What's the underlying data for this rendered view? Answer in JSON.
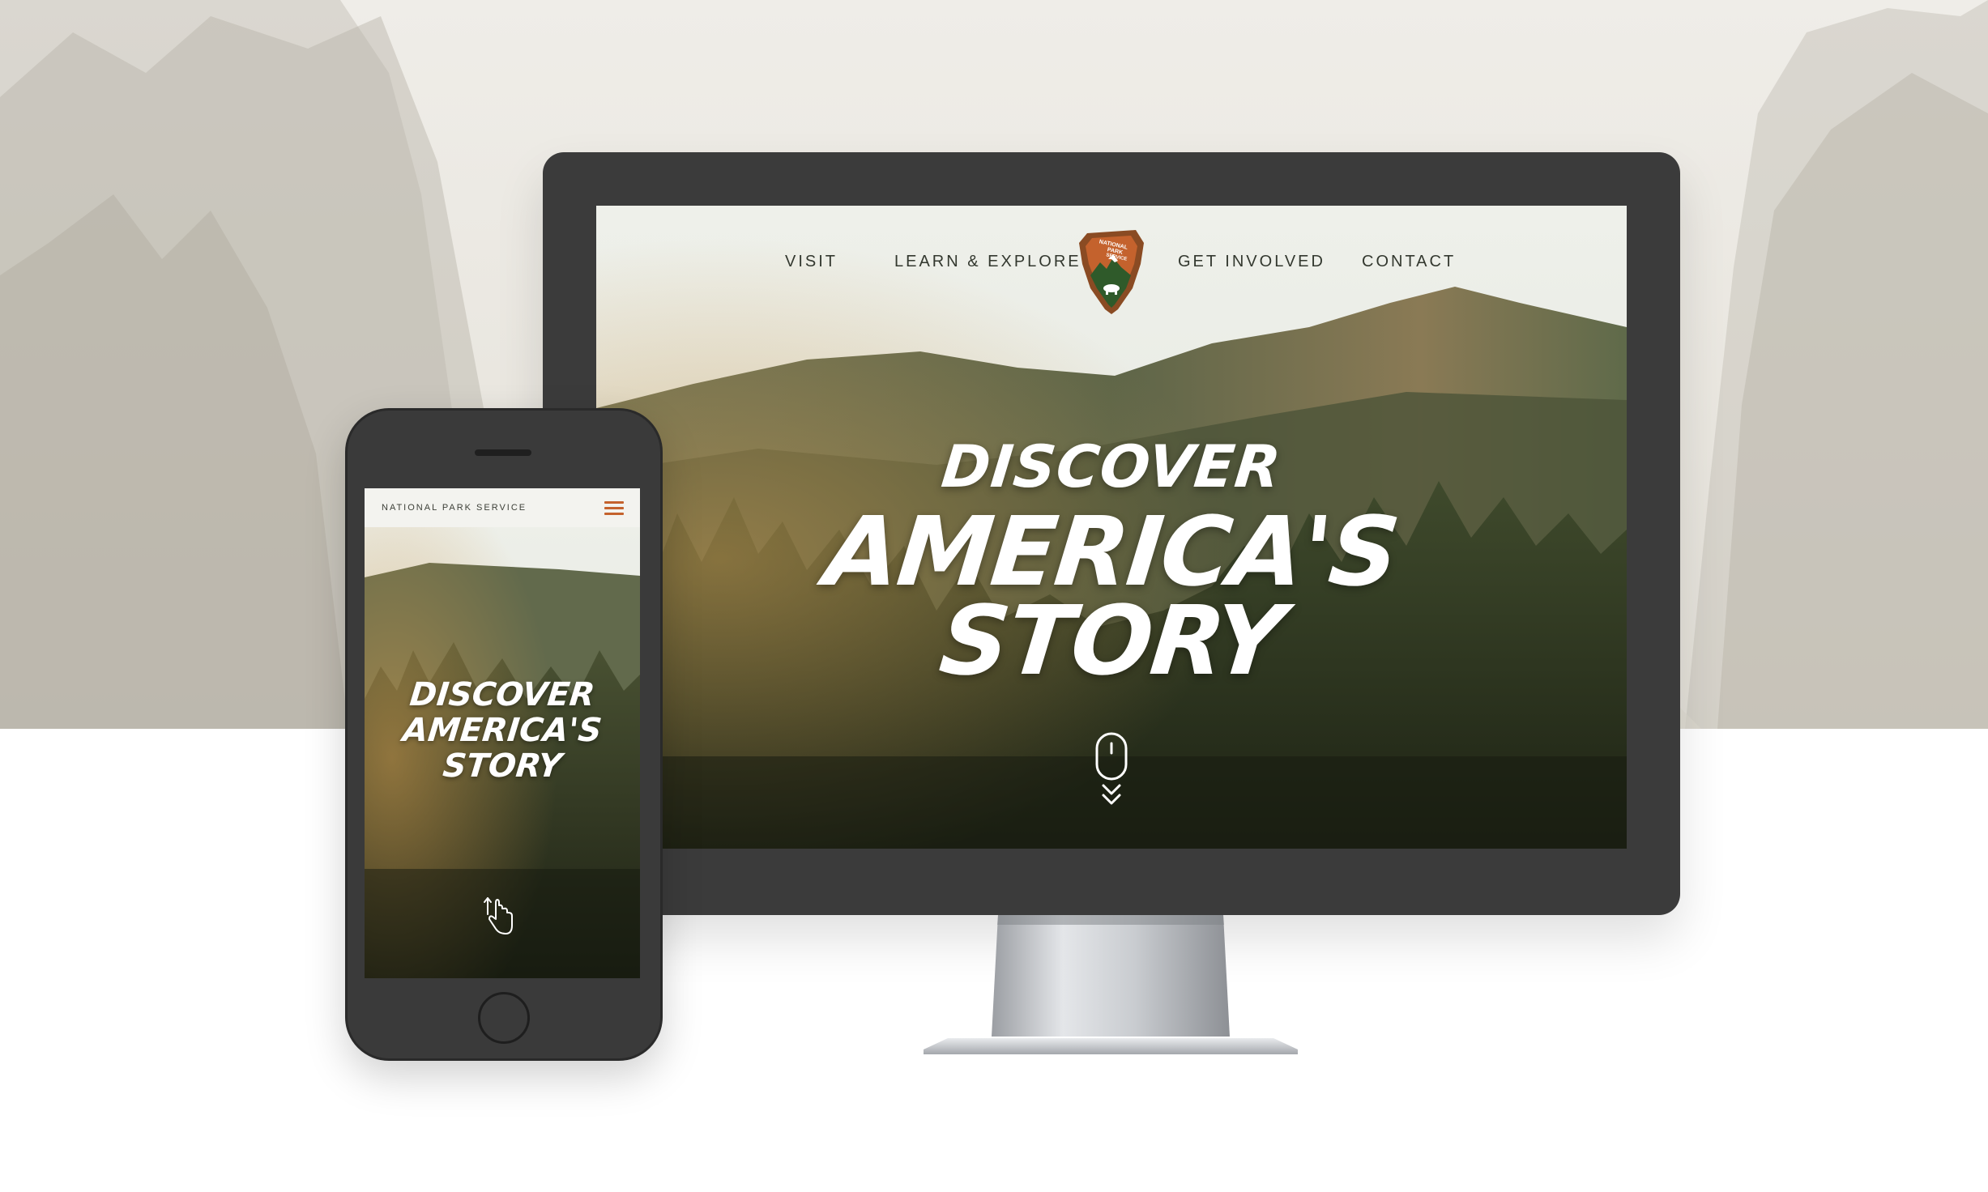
{
  "desktop": {
    "nav": {
      "visit": "VISIT",
      "learn": "LEARN & EXPLORE",
      "involved": "GET INVOLVED",
      "contact": "CONTACT"
    },
    "hero": {
      "line1": "Discover",
      "line2": "America's",
      "line3": "Story"
    },
    "scroll_hint_icon": "mouse-scroll-icon"
  },
  "mobile": {
    "brand": "NATIONAL PARK SERVICE",
    "menu_icon": "hamburger-menu-icon",
    "hero": {
      "line1": "Discover",
      "line2": "America's",
      "line3": "Story"
    },
    "swipe_hint_icon": "swipe-up-hand-icon"
  },
  "logo": {
    "text_lines": [
      "NATIONAL",
      "PARK",
      "SERVICE"
    ]
  },
  "colors": {
    "accent_orange": "#c4622d",
    "logo_brown": "#8a4b23",
    "logo_green": "#2f5a2a",
    "device_frame": "#3b3b3b",
    "nav_text": "#33382f"
  }
}
